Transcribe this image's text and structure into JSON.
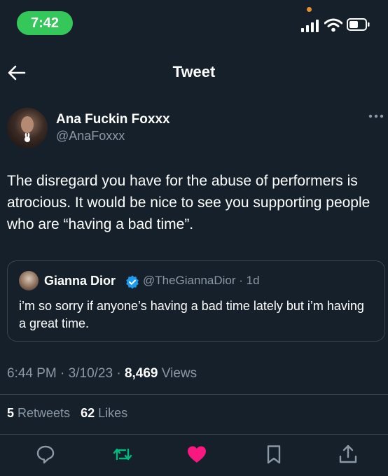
{
  "status_bar": {
    "time": "7:42"
  },
  "header": {
    "title": "Tweet"
  },
  "author": {
    "name": "Ana Fuckin Foxxx",
    "handle": "@AnaFoxxx"
  },
  "tweet": {
    "text": "The disregard you have for the abuse of performers is atrocious. It would be nice to see you supporting people who are “having a bad time”."
  },
  "quote": {
    "name": "Gianna Dior",
    "handle": "@TheGiannaDior",
    "sep": " · ",
    "age": "1d",
    "text": "i’m so sorry if anyone’s having a bad time lately but i’m having a great time."
  },
  "meta": {
    "time": "6:44 PM",
    "sep1": " · ",
    "date": "3/10/23",
    "sep2": " · ",
    "views_count": "8,469",
    "views_label": " Views"
  },
  "stats": {
    "retweets_count": "5",
    "retweets_label": " Retweets",
    "likes_count": "62",
    "likes_label": " Likes"
  },
  "colors": {
    "background": "#15202b",
    "secondary_text": "#8b98a5",
    "retweet_green": "#00ba7c",
    "like_pink": "#f91880",
    "verified_blue": "#1d9bf0",
    "divider": "#38444d"
  },
  "icons": [
    "back-arrow-icon",
    "more-icon",
    "verified-icon",
    "reply-icon",
    "retweet-icon",
    "like-icon",
    "bookmark-icon",
    "share-icon"
  ]
}
